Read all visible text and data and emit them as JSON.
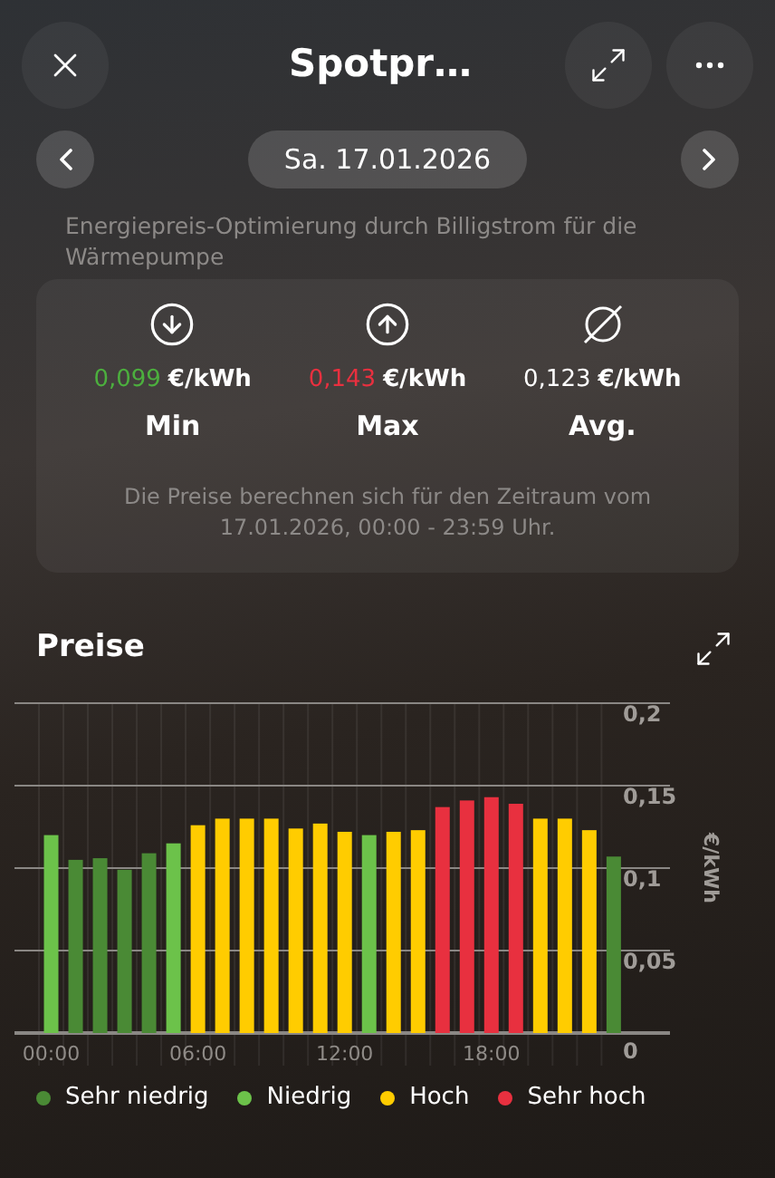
{
  "header": {
    "title": "Spotpr…"
  },
  "date_nav": {
    "date": "Sa. 17.01.2026"
  },
  "description": "Energiepreis-Optimierung durch Billigstrom für die Wärmepumpe",
  "stats": [
    {
      "kind": "min",
      "value": "0,099",
      "unit": "€/kWh",
      "label": "Min",
      "color": "#4caf3e"
    },
    {
      "kind": "max",
      "value": "0,143",
      "unit": "€/kWh",
      "label": "Max",
      "color": "#e8303f"
    },
    {
      "kind": "avg",
      "value": "0,123",
      "unit": "€/kWh",
      "label": "Avg.",
      "color": "#ffffff"
    }
  ],
  "stats_note": "Die Preise berechnen sich für den Zeitraum vom 17.01.2026, 00:00 - 23:59 Uhr.",
  "prices": {
    "title": "Preise",
    "chart_data": {
      "type": "bar",
      "ylabel": "€/kWh",
      "stacked": false,
      "x": [
        0,
        1,
        2,
        3,
        4,
        5,
        6,
        7,
        8,
        9,
        10,
        11,
        12,
        13,
        14,
        15,
        16,
        17,
        18,
        19,
        20,
        21,
        22,
        23
      ],
      "series": [
        {
          "name": "Sehr niedrig",
          "color": "#4a8a35",
          "values": [
            null,
            0.105,
            0.106,
            0.099,
            0.109,
            null,
            null,
            null,
            null,
            null,
            null,
            null,
            null,
            null,
            null,
            null,
            null,
            null,
            null,
            null,
            null,
            null,
            null,
            0.107
          ]
        },
        {
          "name": "Niedrig",
          "color": "#6cc24a",
          "values": [
            0.12,
            null,
            null,
            null,
            null,
            0.115,
            null,
            null,
            null,
            null,
            null,
            null,
            null,
            0.12,
            null,
            null,
            null,
            null,
            null,
            null,
            null,
            null,
            null,
            null
          ]
        },
        {
          "name": "Hoch",
          "color": "#ffcc00",
          "values": [
            null,
            null,
            null,
            null,
            null,
            null,
            0.126,
            0.13,
            0.13,
            0.13,
            0.124,
            0.127,
            0.122,
            null,
            0.122,
            0.123,
            null,
            null,
            null,
            null,
            0.13,
            0.13,
            0.123,
            null
          ]
        },
        {
          "name": "Sehr hoch",
          "color": "#e8303f",
          "values": [
            null,
            null,
            null,
            null,
            null,
            null,
            null,
            null,
            null,
            null,
            null,
            null,
            null,
            null,
            null,
            null,
            0.137,
            0.141,
            0.143,
            0.139,
            null,
            null,
            null,
            null
          ]
        }
      ],
      "ylim": [
        0,
        0.2
      ],
      "xlim": [
        -1.5,
        25.3
      ],
      "grid": true,
      "xticks": [
        {
          "value": 0,
          "label": "00:00"
        },
        {
          "value": 6,
          "label": "06:00"
        },
        {
          "value": 12,
          "label": "12:00"
        },
        {
          "value": 18,
          "label": "18:00"
        }
      ],
      "yticks": [
        {
          "value": 0,
          "label": "0"
        },
        {
          "value": 0.05,
          "label": "0,05"
        },
        {
          "value": 0.1,
          "label": "0,1"
        },
        {
          "value": 0.15,
          "label": "0,15"
        },
        {
          "value": 0.2,
          "label": "0,2"
        }
      ]
    }
  }
}
